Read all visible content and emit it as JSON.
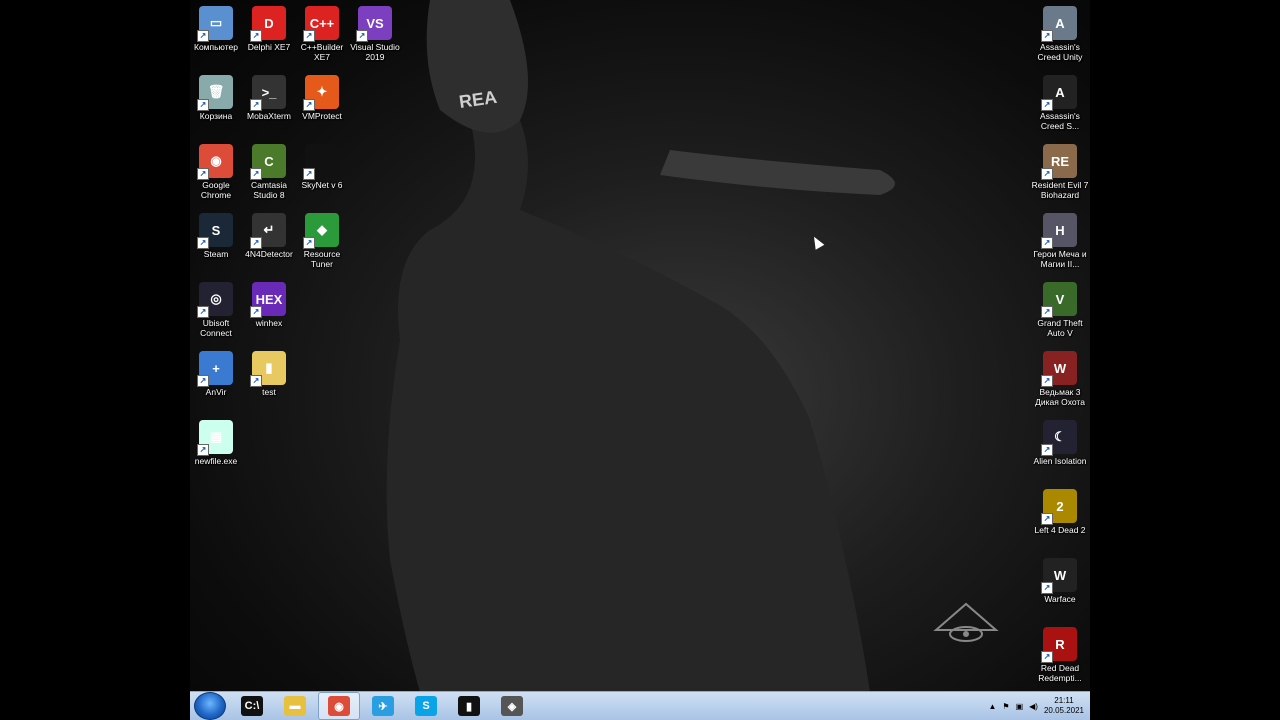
{
  "desktop": {
    "left_icons": [
      {
        "name": "computer-icon",
        "label": "Компьютер",
        "color": "#5a8fd0",
        "glyph": "▭"
      },
      {
        "name": "delphi-icon",
        "label": "Delphi XE7",
        "color": "#d22",
        "glyph": "D"
      },
      {
        "name": "cppbuilder-icon",
        "label": "C++Builder XE7",
        "color": "#d22",
        "glyph": "C++"
      },
      {
        "name": "visual-studio-icon",
        "label": "Visual Studio 2019",
        "color": "#7b3fc0",
        "glyph": "VS"
      },
      {
        "name": "recycle-bin-icon",
        "label": "Корзина",
        "color": "#8aa",
        "glyph": "🗑"
      },
      {
        "name": "mobaxterm-icon",
        "label": "MobaXterm",
        "color": "#333",
        "glyph": ">_"
      },
      {
        "name": "vmprotect-icon",
        "label": "VMProtect",
        "color": "#e55a1a",
        "glyph": "✦"
      },
      {
        "name": "chrome-icon",
        "label": "Google Chrome",
        "color": "#dd4b39",
        "glyph": "◉"
      },
      {
        "name": "camtasia-icon",
        "label": "Camtasia Studio 8",
        "color": "#4a7a2a",
        "glyph": "C"
      },
      {
        "name": "skynet-icon",
        "label": "SkyNet v 6",
        "color": "#111",
        "glyph": ""
      },
      {
        "name": "steam-icon",
        "label": "Steam",
        "color": "#1b2838",
        "glyph": "S"
      },
      {
        "name": "4n4detector-icon",
        "label": "4N4Detector",
        "color": "#333",
        "glyph": "↵"
      },
      {
        "name": "resource-tuner-icon",
        "label": "Resource Tuner",
        "color": "#2a9a3a",
        "glyph": "◆"
      },
      {
        "name": "ubisoft-icon",
        "label": "Ubisoft Connect",
        "color": "#223",
        "glyph": "◎"
      },
      {
        "name": "winhex-icon",
        "label": "winhex",
        "color": "#6a2ab8",
        "glyph": "HEX"
      },
      {
        "name": "anvir-icon",
        "label": "AnVir",
        "color": "#3a7ad0",
        "glyph": "+"
      },
      {
        "name": "test-folder-icon",
        "label": "test",
        "color": "#e8c860",
        "glyph": "▮"
      },
      {
        "name": "newfile-icon",
        "label": "newfile.exe",
        "color": "#cfe",
        "glyph": "▤"
      }
    ],
    "right_icons": [
      {
        "name": "ac-unity-icon",
        "label": "Assassin's Creed Unity",
        "color": "#6a7a8a",
        "glyph": "A"
      },
      {
        "name": "ac-syndicate-icon",
        "label": "Assassin's Creed S...",
        "color": "#222",
        "glyph": "A"
      },
      {
        "name": "re7-icon",
        "label": "Resident Evil 7 Biohazard",
        "color": "#8a6a4a",
        "glyph": "RE"
      },
      {
        "name": "heroes-icon",
        "label": "Герои Меча и Магии II...",
        "color": "#556",
        "glyph": "H"
      },
      {
        "name": "gta5-icon",
        "label": "Grand Theft Auto V",
        "color": "#3a6a2a",
        "glyph": "V"
      },
      {
        "name": "witcher3-icon",
        "label": "Ведьмак 3 Дикая Охота",
        "color": "#822",
        "glyph": "W"
      },
      {
        "name": "alien-icon",
        "label": "Alien Isolation",
        "color": "#223",
        "glyph": "☾"
      },
      {
        "name": "l4d2-icon",
        "label": "Left 4 Dead 2",
        "color": "#a80",
        "glyph": "2"
      },
      {
        "name": "warface-icon",
        "label": "Warface",
        "color": "#222",
        "glyph": "W"
      },
      {
        "name": "rdr-icon",
        "label": "Red Dead Redempti...",
        "color": "#a11",
        "glyph": "R"
      }
    ]
  },
  "taskbar": {
    "clock_time": "21:11",
    "clock_date": "20.05.2021",
    "items": [
      {
        "name": "cmd-taskbar-icon",
        "glyph": "C:\\",
        "color": "#111"
      },
      {
        "name": "explorer-taskbar-icon",
        "glyph": "▬",
        "color": "#e8c040"
      },
      {
        "name": "chrome-taskbar-icon",
        "glyph": "◉",
        "color": "#dd4b39"
      },
      {
        "name": "telegram-taskbar-icon",
        "glyph": "✈",
        "color": "#2a9ee0"
      },
      {
        "name": "skype-taskbar-icon",
        "glyph": "S",
        "color": "#0aa3e8"
      },
      {
        "name": "file-taskbar-icon",
        "glyph": "▮",
        "color": "#111"
      },
      {
        "name": "app-taskbar-icon",
        "glyph": "◈",
        "color": "#555"
      }
    ]
  }
}
